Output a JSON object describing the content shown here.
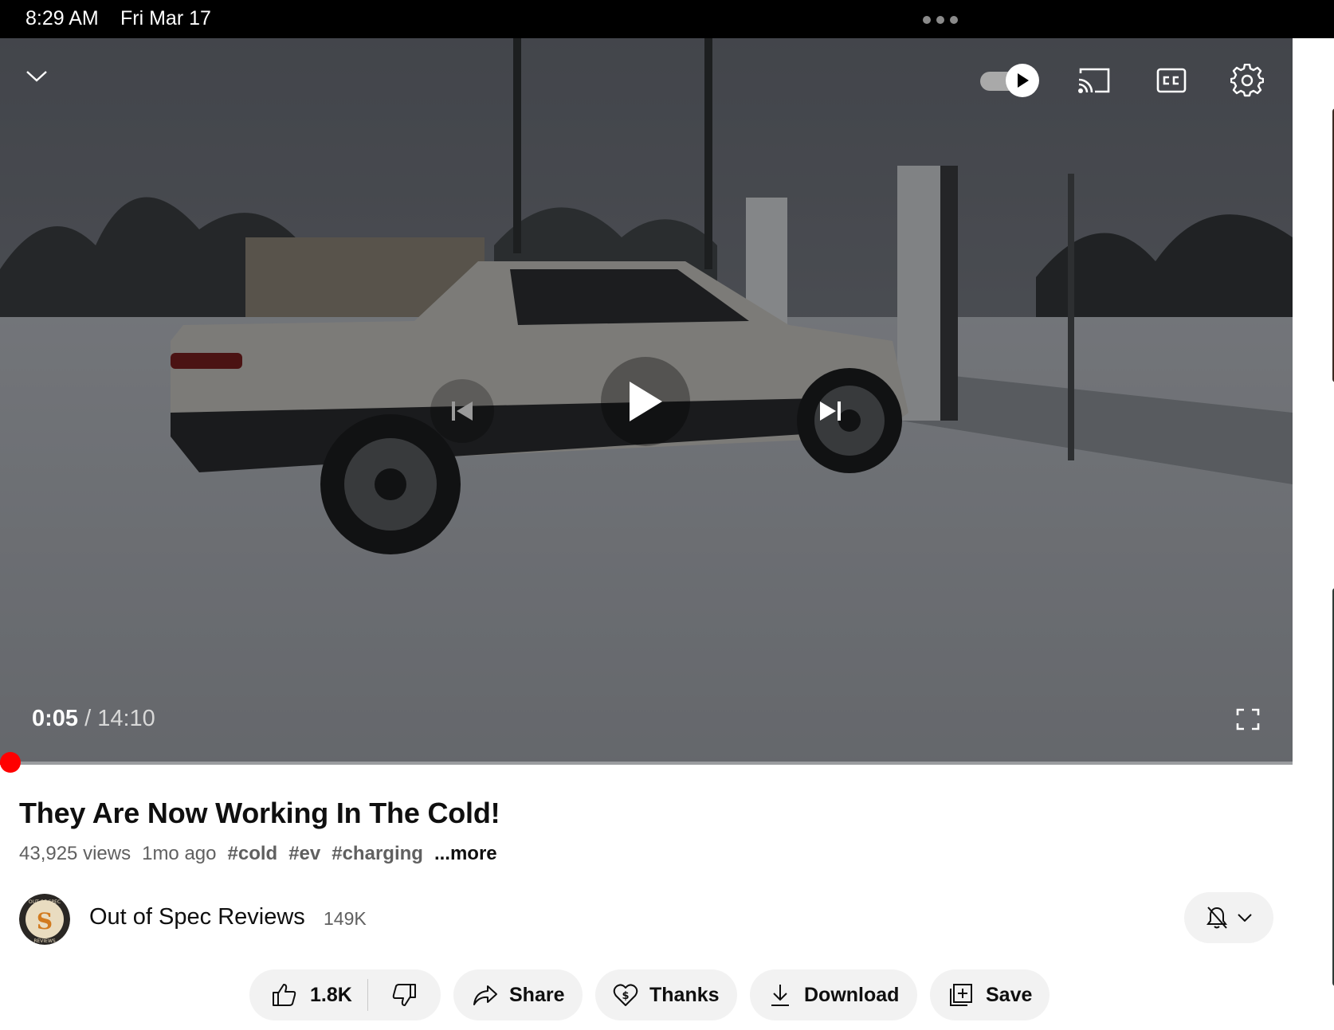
{
  "status_bar": {
    "time": "8:29 AM",
    "date": "Fri Mar 17"
  },
  "player": {
    "current_time": "0:05",
    "separator": "/",
    "duration": "14:10",
    "progress_fraction": 0.006,
    "autoplay_on": true,
    "progress_color": "#ff0000"
  },
  "video": {
    "title": "They Are Now Working In The Cold!",
    "views": "43,925 views",
    "age": "1mo ago",
    "tags": [
      "#cold",
      "#ev",
      "#charging"
    ],
    "more_label": "...more"
  },
  "channel": {
    "name": "Out of Spec Reviews",
    "subscribers": "149K",
    "avatar_text_top": "OUT OF SPEC",
    "avatar_text_bottom": "REVIEWS",
    "avatar_letter": "S"
  },
  "actions": {
    "like_count": "1.8K",
    "share_label": "Share",
    "thanks_label": "Thanks",
    "download_label": "Download",
    "save_label": "Save"
  },
  "icons": {
    "collapse": "chevron-down-icon",
    "cast": "cast-icon",
    "captions": "closed-captions-icon",
    "settings": "gear-icon",
    "previous": "skip-previous-icon",
    "play": "play-icon",
    "next": "skip-next-icon",
    "fullscreen": "fullscreen-icon",
    "notifications": "bell-off-icon",
    "like": "thumbs-up-icon",
    "dislike": "thumbs-down-icon",
    "share": "share-arrow-icon",
    "thanks": "heart-dollar-icon",
    "download": "download-icon",
    "save": "add-to-playlist-icon"
  }
}
